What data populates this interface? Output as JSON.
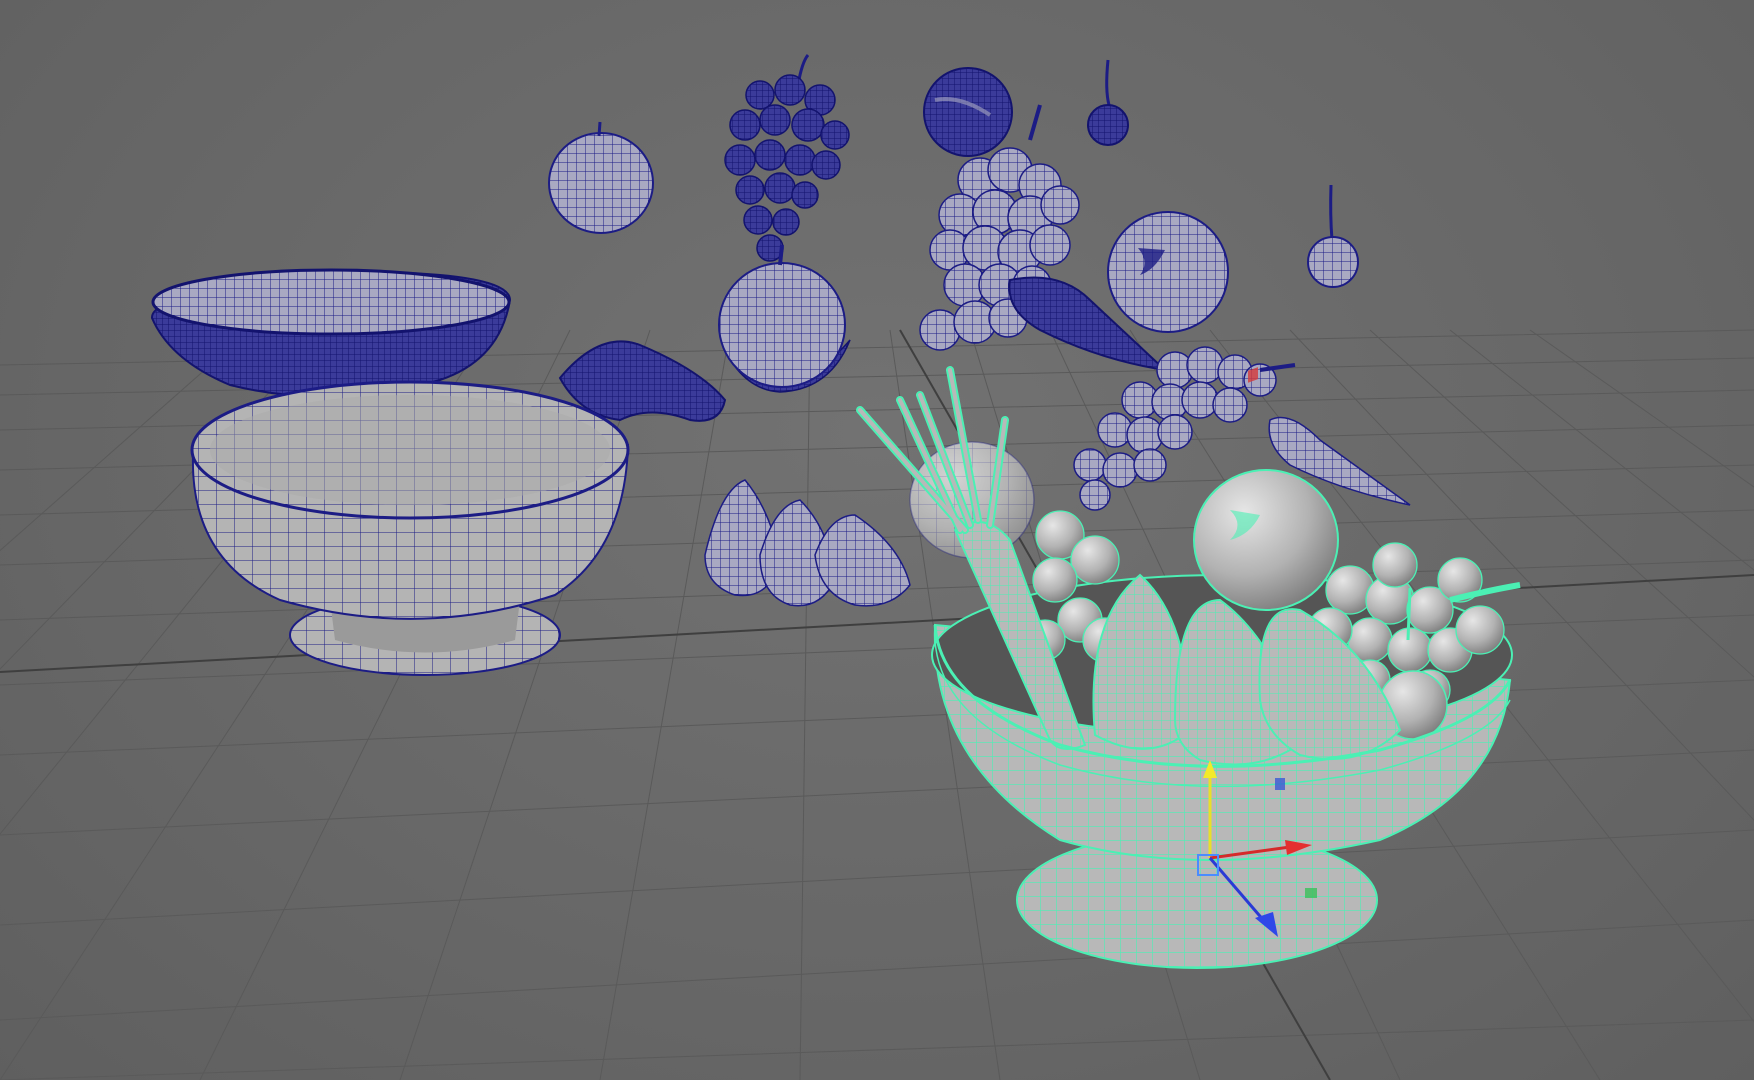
{
  "app": {
    "view": "3D viewport",
    "display_mode": "shaded-wireframe"
  },
  "colors": {
    "background": "#6b6b6b",
    "grid": "#5a5a5a",
    "unselected_wire": "#1c1c85",
    "selected_wire": "#4bf0b4",
    "surface": "#b7b7b7"
  },
  "scene": {
    "objects": [
      {
        "name": "apple",
        "state": "wireframe"
      },
      {
        "name": "grapes",
        "state": "wireframe"
      },
      {
        "name": "orange",
        "state": "wireframe"
      },
      {
        "name": "cherry",
        "state": "wireframe"
      },
      {
        "name": "bowl",
        "state": "wireframe"
      },
      {
        "name": "banana",
        "state": "wireframe"
      },
      {
        "name": "pear",
        "state": "shaded"
      },
      {
        "name": "carrot",
        "state": "shaded"
      },
      {
        "name": "fruit-bowl-assembly",
        "state": "selected"
      }
    ],
    "manipulator": {
      "type": "move",
      "axes": [
        "x",
        "y",
        "z"
      ]
    }
  }
}
